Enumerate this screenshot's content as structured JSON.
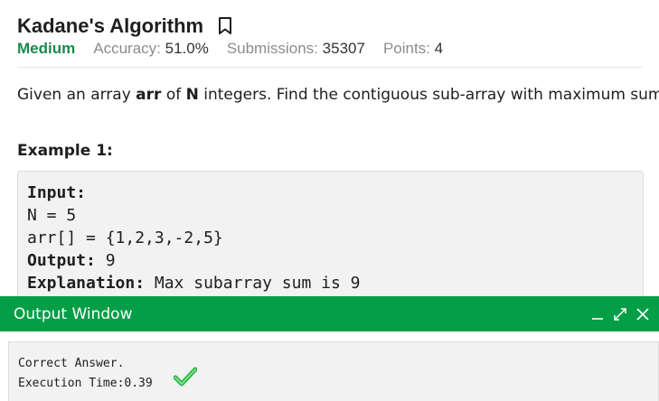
{
  "problem": {
    "title": "Kadane's Algorithm",
    "difficulty": "Medium",
    "accuracy_label": "Accuracy:",
    "accuracy_value": "51.0%",
    "submissions_label": "Submissions:",
    "submissions_value": "35307",
    "points_label": "Points:",
    "points_value": "4",
    "bookmark_icon": "bookmark-icon"
  },
  "statement": {
    "part1": "Given an array ",
    "arr": "arr",
    "part2": " of ",
    "n": "N",
    "part3": " integers. Find the contiguous sub-array with maximum sum."
  },
  "example": {
    "heading": "Example 1:",
    "input_label": "Input:",
    "line_n": "N = 5",
    "line_arr": "arr[] = {1,2,3,-2,5}",
    "output_label": "Output:",
    "output_value": " 9",
    "explanation_label": "Explanation:",
    "explanation_value": " Max subarray sum is 9"
  },
  "output_window": {
    "title": "Output Window",
    "minimize_icon": "minimize-icon",
    "expand_icon": "expand-icon",
    "close_icon": "close-icon",
    "result_text": "Correct Answer.",
    "execution_time": "Execution Time:0.39"
  },
  "colors": {
    "accent_green": "#039e46",
    "difficulty_green": "#1a8a4d",
    "check_green": "#34c759"
  }
}
